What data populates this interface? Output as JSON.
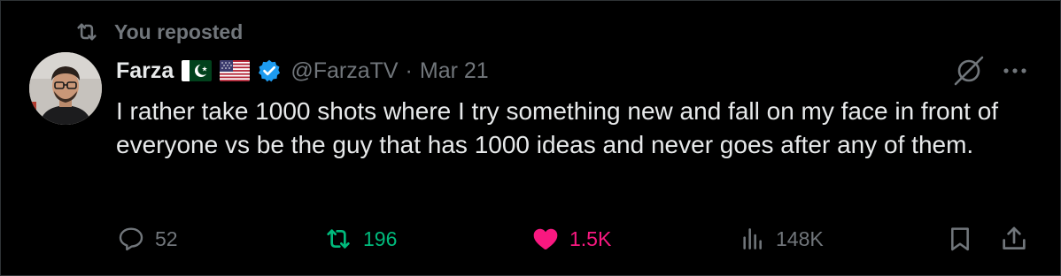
{
  "repost_banner": {
    "label": "You reposted",
    "icon": "repost-icon"
  },
  "author": {
    "display_name": "Farza",
    "flags": [
      "pakistan-flag-icon",
      "usa-flag-icon"
    ],
    "verified": true,
    "handle": "@FarzaTV",
    "separator": "·",
    "date": "Mar 21"
  },
  "tweet": {
    "text": "I rather take 1000 shots where I try something new and fall on my face in front of everyone vs be the guy that has 1000 ideas and never goes after any of them."
  },
  "actions": {
    "replies": "52",
    "reposts": "196",
    "likes": "1.5K",
    "views": "148K"
  },
  "colors": {
    "background": "#000000",
    "text_primary": "#e7e9ea",
    "text_secondary": "#71767b",
    "repost_active": "#00ba7c",
    "like_active": "#f91880",
    "verified_badge": "#1d9bf0"
  }
}
